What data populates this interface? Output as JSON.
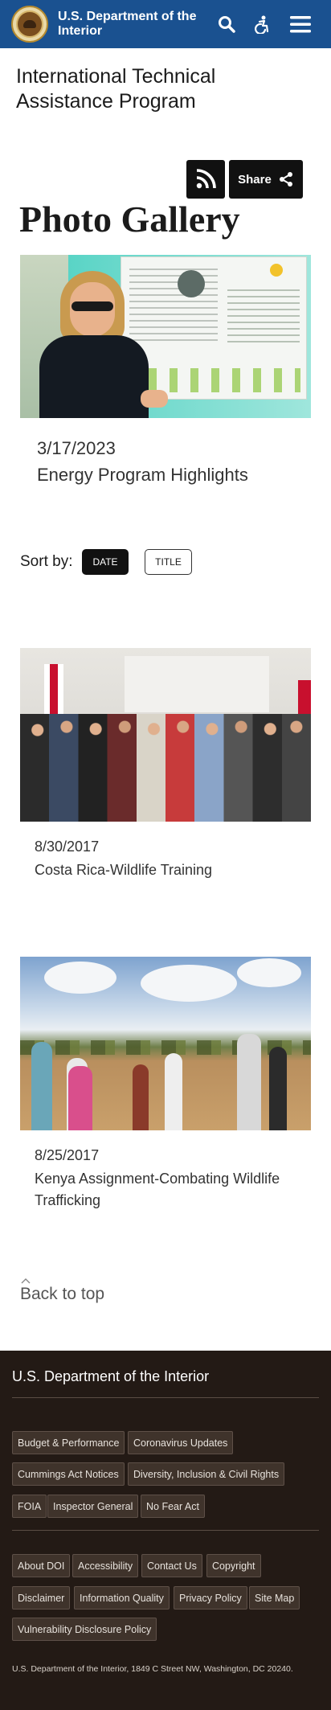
{
  "header": {
    "agency_name": "U.S. Department of the Interior",
    "icons": [
      "doi-seal-icon",
      "search-icon",
      "accessibility-icon",
      "hamburger-menu-icon"
    ],
    "bg_color": "#1a5190"
  },
  "site": {
    "title": "International Technical Assistance Program"
  },
  "actions": {
    "share_label": "Share"
  },
  "page": {
    "heading": "Photo Gallery"
  },
  "featured": {
    "date": "3/17/2023",
    "title": "Energy Program Highlights"
  },
  "sort": {
    "label": "Sort by:",
    "options": [
      "DATE",
      "TITLE"
    ],
    "active": "DATE"
  },
  "gallery": [
    {
      "date": "8/30/2017",
      "title": "Costa Rica-Wildlife Training"
    },
    {
      "date": "8/25/2017",
      "title": "Kenya Assignment-Combating Wildlife Trafficking"
    }
  ],
  "back_to_top": "Back to top",
  "footer": {
    "title": "U.S. Department of the Interior",
    "group1": [
      "Budget & Performance",
      "Coronavirus Updates",
      "Cummings Act Notices",
      "Diversity, Inclusion & Civil Rights",
      "FOIA",
      "Inspector General",
      "No Fear Act"
    ],
    "group2": [
      "About DOI",
      "Accessibility",
      "Contact Us",
      "Copyright",
      "Disclaimer",
      "Information Quality",
      "Privacy Policy",
      "Site Map",
      "Vulnerability Disclosure Policy"
    ],
    "address": "U.S. Department of the Interior, 1849 C Street NW, Washington, DC 20240.",
    "bg_color": "#231a15"
  }
}
